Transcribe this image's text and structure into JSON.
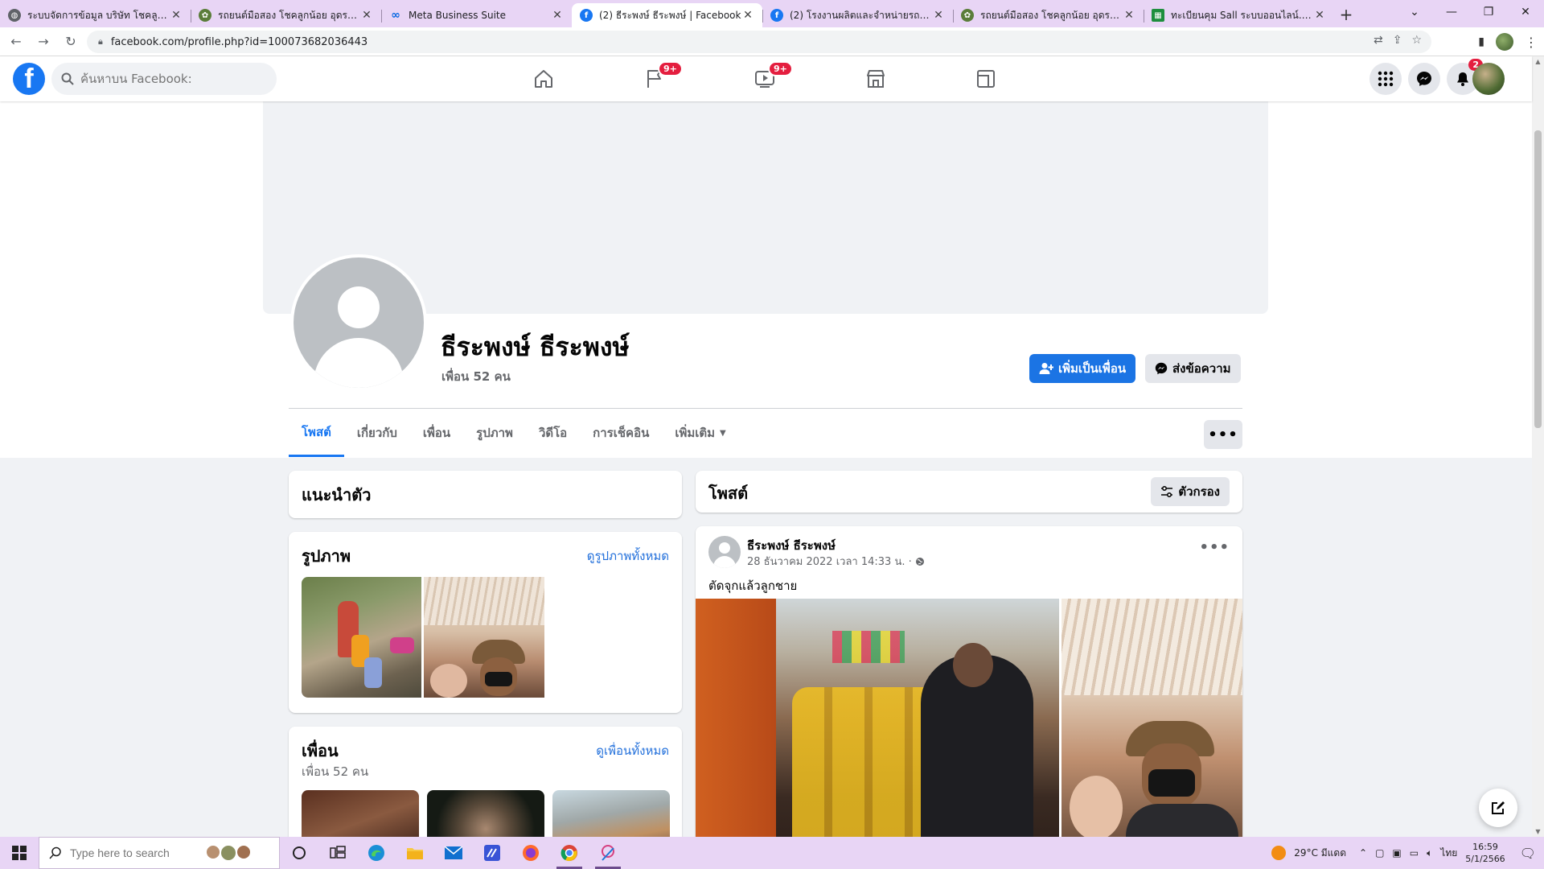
{
  "browser": {
    "tabs": [
      {
        "title": "ระบบจัดการข้อมูล บริษัท โชคลูกน้อย",
        "icon": "globe-icon",
        "active": false
      },
      {
        "title": "รถยนต์มือสอง โชคลูกน้อย อุดรธานี",
        "icon": "site-icon",
        "active": false
      },
      {
        "title": "Meta Business Suite",
        "icon": "meta-icon",
        "active": false
      },
      {
        "title": "(2) ธีระพงษ์ ธีระพงษ์ | Facebook",
        "icon": "facebook-icon",
        "active": true
      },
      {
        "title": "(2) โรงงานผลิตและจำหน่ายรถยนต์ไฟ",
        "icon": "facebook-icon",
        "active": false
      },
      {
        "title": "รถยนต์มือสอง โชคลูกน้อย อุดรธานี",
        "icon": "site-icon",
        "active": false
      },
      {
        "title": "ทะเบียนคุม Sall ระบบออนไลน์.xlsx - G",
        "icon": "sheets-icon",
        "active": false
      }
    ],
    "url": "facebook.com/profile.php?id=100073682036443"
  },
  "fb_nav": {
    "search_placeholder": "ค้นหาบน Facebook:",
    "pages_badge": "9+",
    "watch_badge": "9+",
    "notifications_badge": "2"
  },
  "profile": {
    "name": "ธีระพงษ์ ธีระพงษ์",
    "friends": "เพื่อน 52 คน",
    "add_friend_label": "เพิ่มเป็นเพื่อน",
    "message_label": "ส่งข้อความ",
    "tabs": [
      "โพสต์",
      "เกี่ยวกับ",
      "เพื่อน",
      "รูปภาพ",
      "วิดีโอ",
      "การเช็คอิน",
      "เพิ่มเติม"
    ]
  },
  "intro": {
    "title": "แนะนำตัว"
  },
  "photos": {
    "title": "รูปภาพ",
    "see_all": "ดูรูปภาพทั้งหมด"
  },
  "friends_card": {
    "title": "เพื่อน",
    "count": "เพื่อน 52 คน",
    "see_all": "ดูเพื่อนทั้งหมด"
  },
  "posts_header": {
    "title": "โพสต์",
    "filter_label": "ตัวกรอง"
  },
  "post": {
    "author": "ธีระพงษ์ ธีระพงษ์",
    "timestamp": "28 ธันวาคม 2022 เวลา 14:33 น. ·",
    "text": "ตัดจุกแล้วลูกชาย"
  },
  "taskbar": {
    "search_placeholder": "Type here to search",
    "weather": "29°C มีแดด",
    "language": "ไทย",
    "time": "16:59",
    "date": "5/1/2566"
  },
  "colors": {
    "facebook_blue": "#1877f2",
    "badge_red": "#e41e3f",
    "chrome_tint": "#e8d5f5"
  }
}
